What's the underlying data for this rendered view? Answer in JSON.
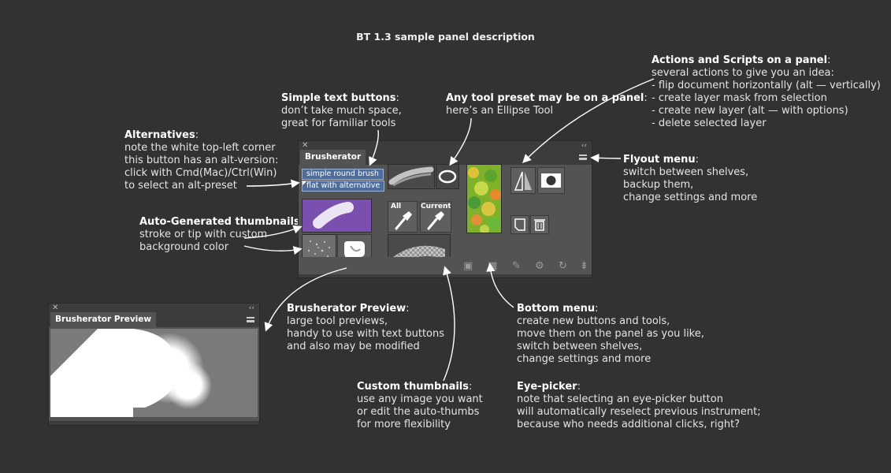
{
  "page_title": "BT 1.3 sample panel description",
  "brusherator_panel": {
    "tab": "Brusherator",
    "text_buttons": [
      "simple round brush",
      "flat with alternative"
    ],
    "eye_picker_labels": [
      "All",
      "Current"
    ]
  },
  "preview_panel": {
    "tab": "Brusherator Preview"
  },
  "annotations": {
    "alternatives": {
      "title": "Alternatives",
      "lines": [
        "note the white top-left corner",
        "this button has an alt-version:",
        "click with Cmd(Mac)/Ctrl(Win)",
        "to select an alt-preset"
      ]
    },
    "simple_text_buttons": {
      "title": "Simple text buttons",
      "lines": [
        "don’t take much space,",
        "great for familiar tools"
      ]
    },
    "any_tool_preset": {
      "title": "Any tool preset may be on a panel",
      "lines": [
        "here’s an Ellipse Tool"
      ]
    },
    "actions_scripts": {
      "title": "Actions and Scripts on a panel",
      "lines": [
        "several actions to give you an idea:",
        "- flip document horizontally (alt — vertically)",
        "- create layer mask from selection",
        "- create new layer (alt — with options)",
        "- delete selected layer"
      ]
    },
    "flyout_menu": {
      "title": "Flyout menu",
      "lines": [
        "switch between shelves,",
        "backup them,",
        "change settings and more"
      ]
    },
    "auto_thumbnails": {
      "title": "Auto-Generated thumbnails",
      "lines": [
        "stroke or tip with custom",
        "background color"
      ]
    },
    "preview_note": {
      "title": "Brusherator Preview",
      "lines": [
        "large tool previews,",
        "handy to use with text buttons",
        "and also may be modified"
      ]
    },
    "bottom_menu": {
      "title": "Bottom menu",
      "lines": [
        "create new buttons and tools,",
        "move them on the panel as you like,",
        "switch between shelves,",
        "change settings and more"
      ]
    },
    "custom_thumbnails": {
      "title": "Custom thumbnails",
      "lines": [
        "use any image you want",
        "or edit the auto-thumbs",
        "for more flexibility"
      ]
    },
    "eye_picker": {
      "title": "Eye-picker",
      "lines": [
        "note that selecting an eye-picker button",
        "will automatically reselect previous instrument;",
        "because who needs additional clicks, right?"
      ]
    }
  },
  "colors": {
    "background": "#323232",
    "panel": "#535353",
    "text_button": "#4e6d9a",
    "thumb_purple": "#7a4fb0"
  },
  "icons": [
    "close-icon",
    "collapse-icon",
    "flyout-menu-icon",
    "ellipse-tool-icon",
    "flip-horizontal-icon",
    "layer-mask-icon",
    "new-layer-icon",
    "trash-icon",
    "eyedropper-icon",
    "new-button-icon",
    "grid-icon",
    "edit-icon",
    "gear-icon",
    "refresh-icon",
    "shelves-icon"
  ]
}
